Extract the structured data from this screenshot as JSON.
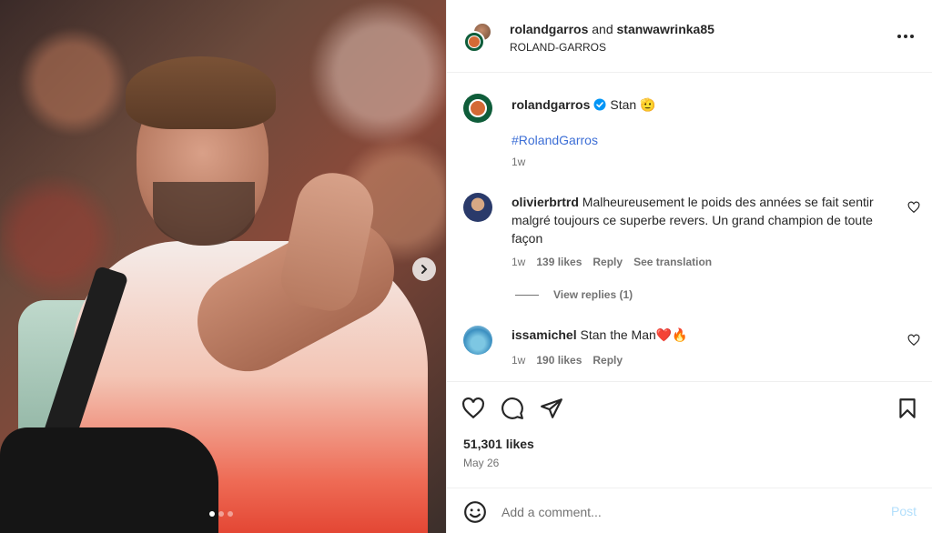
{
  "photo": {
    "alt_icon": "tennis-player-photo",
    "carousel_dots": 3,
    "active_dot": 0
  },
  "header": {
    "account_1": "rolandgarros",
    "joiner": "and",
    "account_2": "stanwawrinka85",
    "subtitle": "ROLAND-GARROS"
  },
  "caption": {
    "username": "rolandgarros",
    "text": "Stan 🫡",
    "hashtag": "#RolandGarros",
    "time": "1w"
  },
  "comments": [
    {
      "username": "olivierbrtrd",
      "text": "Malheureusement le poids des années se fait sentir malgré toujours ce superbe revers. Un grand champion de toute façon",
      "time": "1w",
      "likes": "139 likes",
      "reply": "Reply",
      "translate": "See translation",
      "view_replies": "View replies (1)"
    },
    {
      "username": "issamichel",
      "text": "Stan the Man❤️🔥",
      "time": "1w",
      "likes": "190 likes",
      "reply": "Reply"
    }
  ],
  "actions": {
    "likes": "51,301 likes",
    "date": "May 26"
  },
  "comment_box": {
    "placeholder": "Add a comment...",
    "post_label": "Post"
  },
  "colors": {
    "link": "#3d6fd6",
    "verified": "#0095f6",
    "post_disabled": "#b2dffc",
    "heart_red": "#e0245e"
  }
}
